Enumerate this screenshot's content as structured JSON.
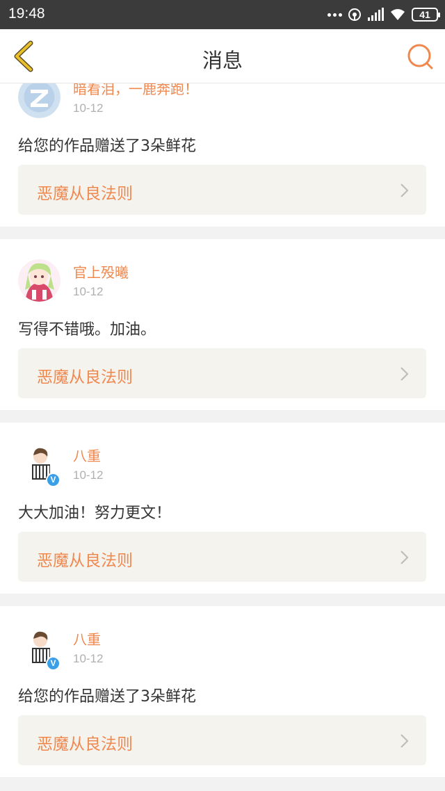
{
  "status_bar": {
    "time": "19:48",
    "battery": "41",
    "icons": [
      "more-dots-icon",
      "hotspot-icon",
      "signal-icon",
      "wifi-icon",
      "battery-icon"
    ]
  },
  "header": {
    "title": "消息",
    "back_icon": "chevron-left-icon",
    "search_icon": "search-icon",
    "accent_color": "#f0884e",
    "back_color": "#e8c02a"
  },
  "messages": [
    {
      "user": "暗看泪，一鹿奔跑！",
      "date": "10-12",
      "text": "给您的作品赠送了3朵鲜花",
      "work": "恶魔从良法则",
      "avatar": "default-qq-avatar",
      "verified": false
    },
    {
      "user": "官上殁曦",
      "date": "10-12",
      "text": "写得不错哦。加油。",
      "work": "恶魔从良法则",
      "avatar": "anime-girl-avatar",
      "verified": false
    },
    {
      "user": "八重",
      "date": "10-12",
      "text": "大大加油！努力更文！",
      "work": "恶魔从良法则",
      "avatar": "chibi-piano-avatar",
      "verified": true,
      "badge": "V"
    },
    {
      "user": "八重",
      "date": "10-12",
      "text": "给您的作品赠送了3朵鲜花",
      "work": "恶魔从良法则",
      "avatar": "chibi-piano-avatar",
      "verified": true,
      "badge": "V"
    }
  ]
}
